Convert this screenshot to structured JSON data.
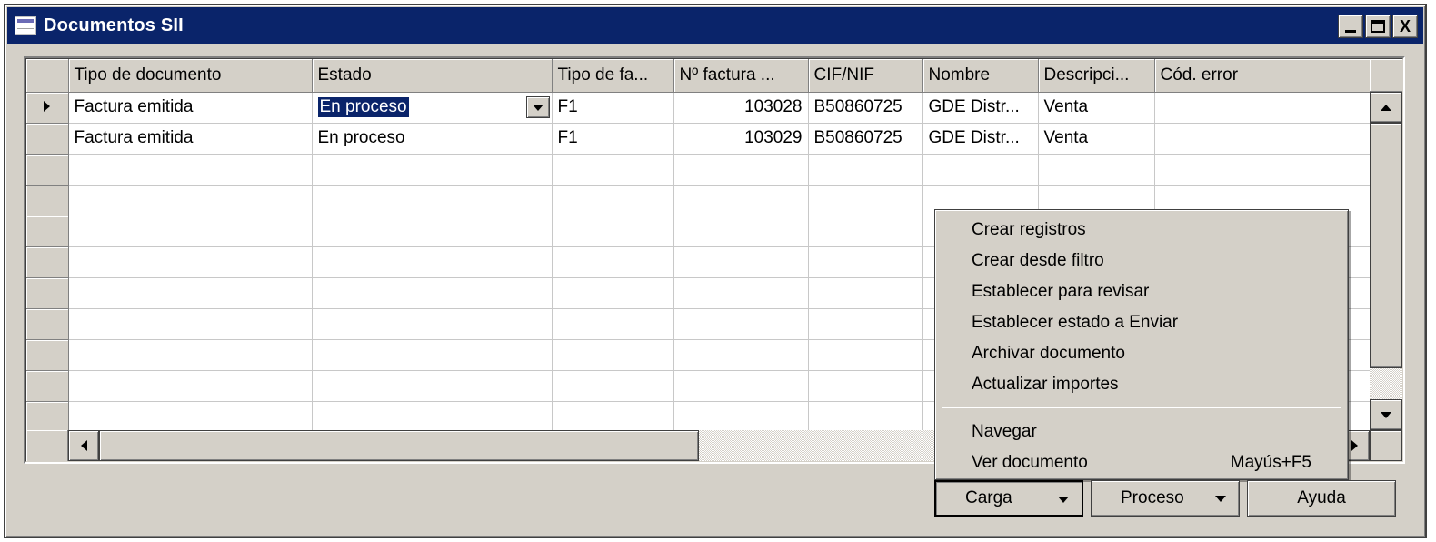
{
  "window": {
    "title": "Documentos SII",
    "buttons": {
      "minimize_icon": "minimize-icon",
      "maximize_icon": "maximize-icon",
      "close_label": "X"
    }
  },
  "grid": {
    "columns": [
      "Tipo de documento",
      "Estado",
      "Tipo de fa...",
      "Nº factura ...",
      "CIF/NIF",
      "Nombre",
      "Descripci...",
      "Cód. error"
    ],
    "rows": [
      {
        "tipo_documento": "Factura emitida",
        "estado": "En proceso",
        "tipo_factura": "F1",
        "num_factura": "103028",
        "cif_nif": "B50860725",
        "nombre": "GDE Distr...",
        "descripcion": "Venta",
        "cod_error": ""
      },
      {
        "tipo_documento": "Factura emitida",
        "estado": "En proceso",
        "tipo_factura": "F1",
        "num_factura": "103029",
        "cif_nif": "B50860725",
        "nombre": "GDE Distr...",
        "descripcion": "Venta",
        "cod_error": ""
      }
    ],
    "selected_row": 0,
    "empty_rows": 9
  },
  "context_menu": {
    "items": [
      {
        "label": "Crear registros",
        "shortcut": ""
      },
      {
        "label": "Crear desde filtro",
        "shortcut": ""
      },
      {
        "label": "Establecer para revisar",
        "shortcut": ""
      },
      {
        "label": "Establecer estado a Enviar",
        "shortcut": ""
      },
      {
        "label": "Archivar documento",
        "shortcut": ""
      },
      {
        "label": "Actualizar importes",
        "shortcut": ""
      },
      {
        "label": "Navegar",
        "shortcut": ""
      },
      {
        "label": "Ver documento",
        "shortcut": "Mayús+F5"
      }
    ]
  },
  "footer": {
    "carga_label": "Carga",
    "proceso_label": "Proceso",
    "ayuda_label": "Ayuda"
  },
  "colors": {
    "titlebar": "#0a246a",
    "face": "#d4d0c8",
    "selection": "#0a246a"
  }
}
